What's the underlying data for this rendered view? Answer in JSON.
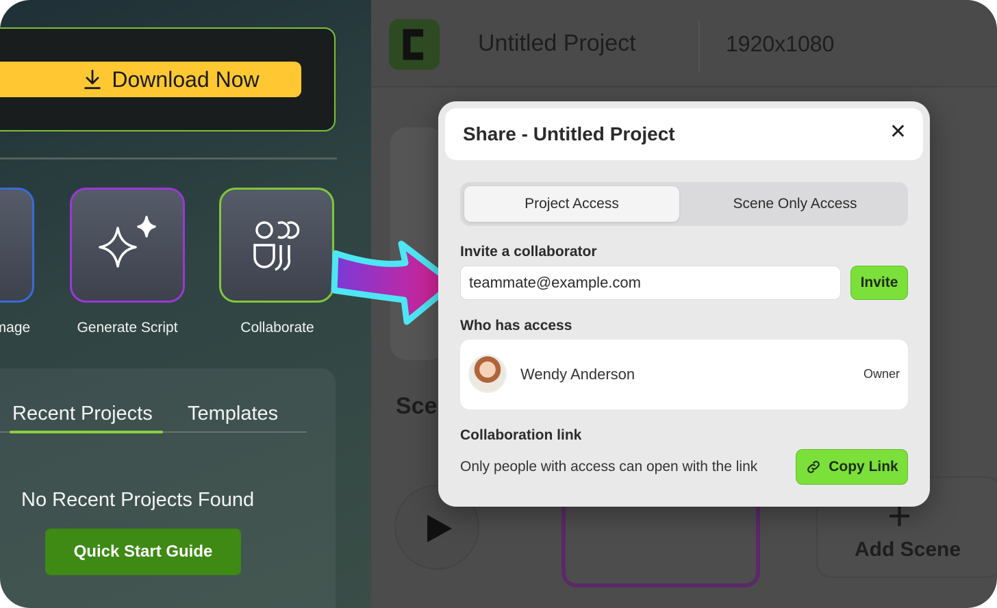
{
  "left_panel": {
    "download_label": "Download Now",
    "tools": [
      {
        "label": "Image",
        "icon": "image-icon"
      },
      {
        "label": "Generate Script",
        "icon": "sparkle-icon"
      },
      {
        "label": "Collaborate",
        "icon": "people-icon"
      }
    ],
    "tabs": [
      {
        "label": "Recent Projects",
        "active": true
      },
      {
        "label": "Templates",
        "active": false
      }
    ],
    "empty_state": "No Recent Projects Found",
    "quick_start_label": "Quick Start Guide",
    "colors": {
      "accent_yellow": "#ffc832",
      "accent_green": "#8ccf3c",
      "tab_indicator": "#8ccf3c"
    }
  },
  "editor": {
    "project_title": "Untitled Project",
    "resolution": "1920x1080",
    "scenes_label": "Sce",
    "add_scene_label": "Add Scene"
  },
  "share_dialog": {
    "title": "Share - Untitled Project",
    "close_glyph": "✕",
    "tabs": [
      {
        "label": "Project Access",
        "active": true
      },
      {
        "label": "Scene Only Access",
        "active": false
      }
    ],
    "invite_heading": "Invite a collaborator",
    "email_value": "teammate@example.com",
    "invite_label": "Invite",
    "access_heading": "Who has access",
    "members": [
      {
        "name": "Wendy Anderson",
        "role": "Owner"
      }
    ],
    "link_heading": "Collaboration link",
    "link_note": "Only people with access can open with the link",
    "copy_label": "Copy Link",
    "colors": {
      "button_green": "#7ce03a"
    }
  }
}
